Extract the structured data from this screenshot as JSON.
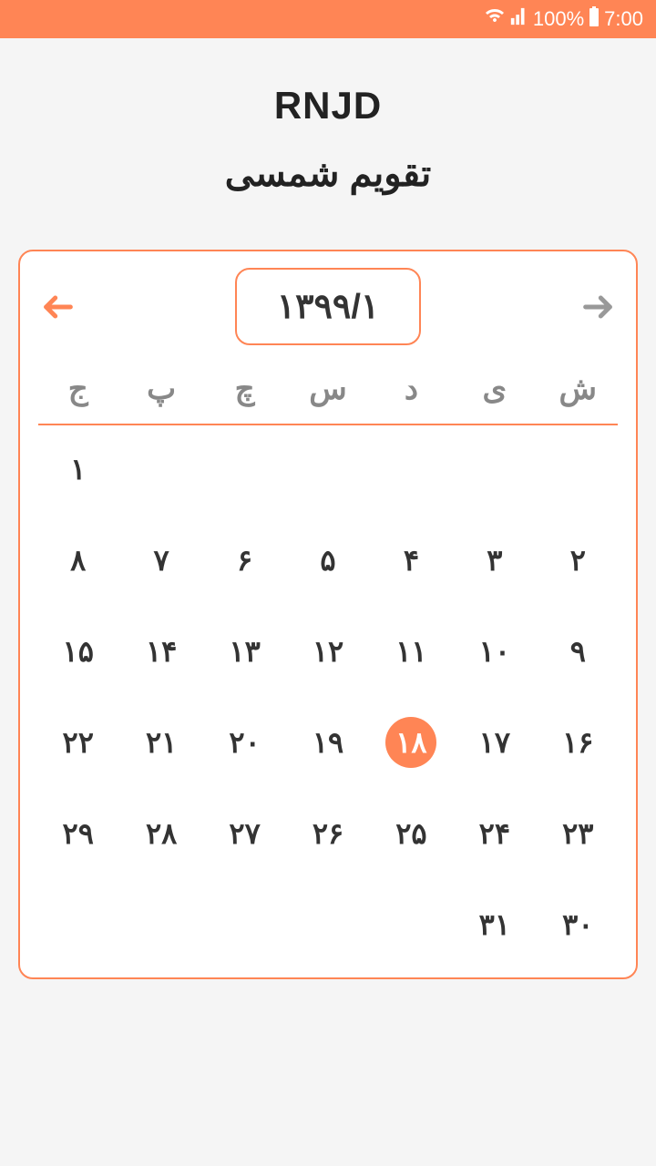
{
  "status_bar": {
    "battery": "100%",
    "time": "7:00"
  },
  "header": {
    "title": "RNJD",
    "subtitle": "تقویم شمسی"
  },
  "calendar": {
    "month_label": "۱۳۹۹/۱",
    "week_days": [
      "ج",
      "پ",
      "چ",
      "س",
      "د",
      "ی",
      "ش"
    ],
    "selected_day": "۱۸",
    "days": [
      [
        "۱",
        "",
        "",
        "",
        "",
        "",
        ""
      ],
      [
        "۸",
        "۷",
        "۶",
        "۵",
        "۴",
        "۳",
        "۲"
      ],
      [
        "۱۵",
        "۱۴",
        "۱۳",
        "۱۲",
        "۱۱",
        "۱۰",
        "۹"
      ],
      [
        "۲۲",
        "۲۱",
        "۲۰",
        "۱۹",
        "۱۸",
        "۱۷",
        "۱۶"
      ],
      [
        "۲۹",
        "۲۸",
        "۲۷",
        "۲۶",
        "۲۵",
        "۲۴",
        "۲۳"
      ],
      [
        "",
        "",
        "",
        "",
        "",
        "۳۱",
        "۳۰"
      ]
    ]
  }
}
